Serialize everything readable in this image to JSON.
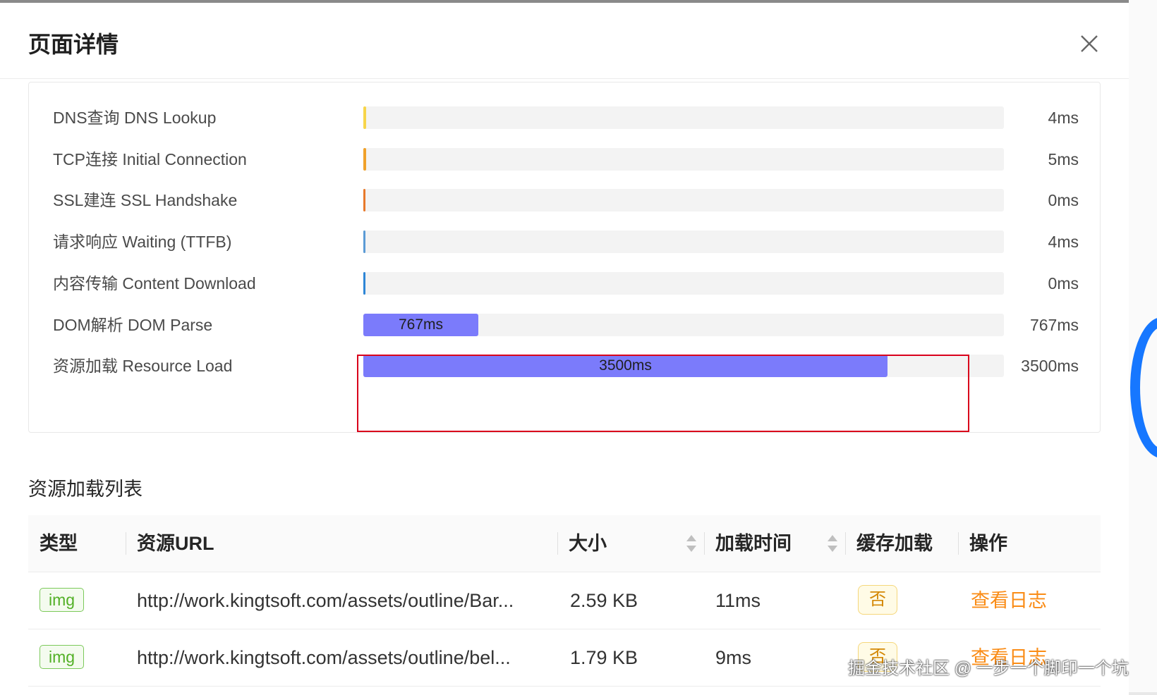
{
  "modal": {
    "title": "页面详情"
  },
  "timings": [
    {
      "label": "DNS查询 DNS Lookup",
      "value": "4ms",
      "bar_text": "",
      "fraction": 0.004,
      "color": "#f7d54a"
    },
    {
      "label": "TCP连接 Initial Connection",
      "value": "5ms",
      "bar_text": "",
      "fraction": 0.004,
      "color": "#f0a12a"
    },
    {
      "label": "SSL建连 SSL Handshake",
      "value": "0ms",
      "bar_text": "",
      "fraction": 0.003,
      "color": "#e8792b"
    },
    {
      "label": "请求响应 Waiting (TTFB)",
      "value": "4ms",
      "bar_text": "",
      "fraction": 0.003,
      "color": "#5b9bd5"
    },
    {
      "label": "内容传输 Content Download",
      "value": "0ms",
      "bar_text": "",
      "fraction": 0.003,
      "color": "#2e86d6"
    },
    {
      "label": "DOM解析 DOM Parse",
      "value": "767ms",
      "bar_text": "767ms",
      "fraction": 0.179,
      "color": "#7b7bfb"
    },
    {
      "label": "资源加载 Resource Load",
      "value": "3500ms",
      "bar_text": "3500ms",
      "fraction": 0.818,
      "color": "#7b7bfb"
    }
  ],
  "resource_list": {
    "title": "资源加载列表",
    "columns": {
      "type": "类型",
      "url": "资源URL",
      "size": "大小",
      "load_time": "加载时间",
      "cache": "缓存加载",
      "action": "操作"
    },
    "rows": [
      {
        "type": "img",
        "url": "http://work.kingtsoft.com/assets/outline/Bar...",
        "size": "2.59 KB",
        "load_time": "11ms",
        "cache": "否",
        "action": "查看日志"
      },
      {
        "type": "img",
        "url": "http://work.kingtsoft.com/assets/outline/bel...",
        "size": "1.79 KB",
        "load_time": "9ms",
        "cache": "否",
        "action": "查看日志"
      }
    ]
  },
  "watermark": "掘金技术社区 @ 一步一个脚印一个坑",
  "icons": {
    "close": "close-icon",
    "sort": "sort-caret-icon"
  }
}
